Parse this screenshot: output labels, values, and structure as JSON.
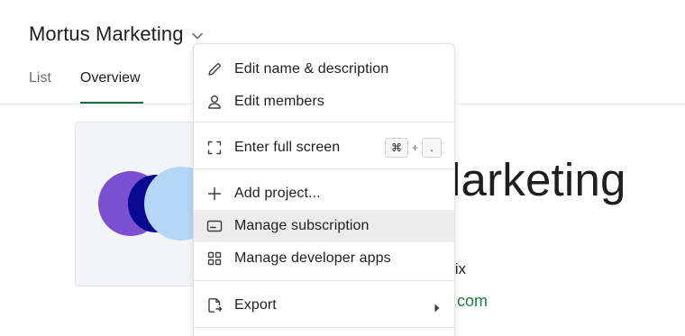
{
  "header": {
    "project_title": "Mortus Marketing",
    "title_icon": "chevron-down-icon"
  },
  "tabs": [
    {
      "label": "List",
      "active": false
    },
    {
      "label": "Overview",
      "active": true
    }
  ],
  "overview": {
    "project_name_fragment": "larketing",
    "owner_fragment": "tix",
    "link_fragment": ".com",
    "cover_colors": [
      "#7a4fd0",
      "#08098f",
      "#b5d6f6"
    ]
  },
  "menu": {
    "items": [
      {
        "label": "Edit name & description",
        "icon": "pencil-icon"
      },
      {
        "label": "Edit members",
        "icon": "person-icon"
      },
      {
        "label": "Enter full screen",
        "icon": "fullscreen-icon",
        "shortcut": [
          "⌘",
          "+",
          "."
        ]
      },
      {
        "label": "Add project...",
        "icon": "plus-icon"
      },
      {
        "label": "Manage subscription",
        "icon": "card-icon",
        "highlighted": true
      },
      {
        "label": "Manage developer apps",
        "icon": "apps-grid-icon"
      },
      {
        "label": "Export",
        "icon": "export-icon",
        "submenu_icon": "chevron-right-icon"
      }
    ]
  },
  "colors": {
    "accent_green": "#1e7d46",
    "tab_underline": "#1e6b3f",
    "menu_hover": "#ececec"
  }
}
